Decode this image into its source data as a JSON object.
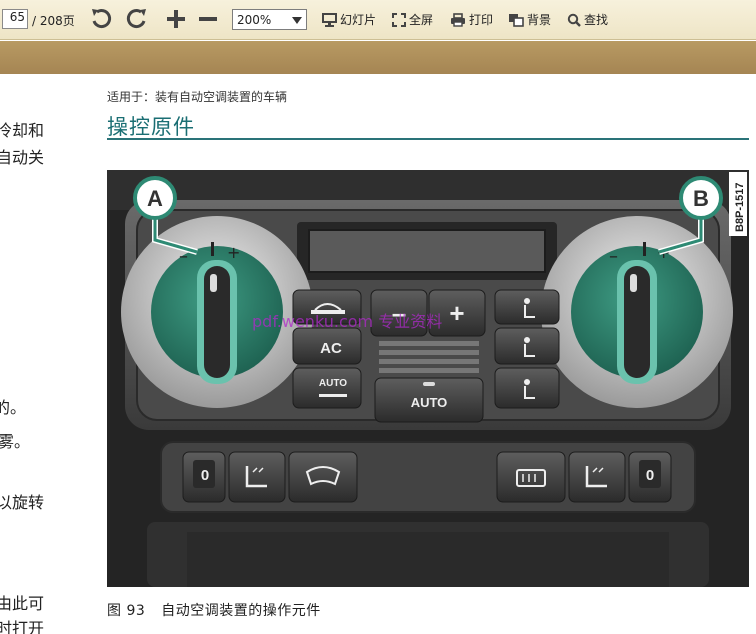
{
  "toolbar": {
    "page_current": "65",
    "page_total": "/ 208页",
    "zoom": "200%",
    "actions": [
      {
        "label": "幻灯片",
        "icon": "slideshow-icon"
      },
      {
        "label": "全屏",
        "icon": "fullscreen-icon"
      },
      {
        "label": "打印",
        "icon": "print-icon"
      },
      {
        "label": "背景",
        "icon": "background-icon"
      },
      {
        "label": "查找",
        "icon": "search-icon"
      }
    ]
  },
  "left_fragments": [
    "冷却和",
    "自动关",
    "的。",
    "雾。",
    "以旋转",
    "由此可",
    "时打开"
  ],
  "content": {
    "applies_to": "适用于：装有自动空调装置的车辆",
    "heading": "操控原件",
    "figure": {
      "label_a": "A",
      "label_b": "B",
      "code": "B8P-1517",
      "watermark": "pdf.wenku.com 专业资料",
      "buttons": {
        "ac": "AC",
        "auto_small": "AUTO",
        "auto": "AUTO",
        "minus": "–",
        "plus": "+",
        "seat_left": "0",
        "seat_right": "0"
      }
    },
    "caption_num": "图 93",
    "caption_text": "自动空调装置的操作元件"
  },
  "colors": {
    "heading": "#1a6e73",
    "toolbar_bg": "#f2ead0",
    "band": "#ad8d59",
    "knob_green": "#2e8a74"
  }
}
